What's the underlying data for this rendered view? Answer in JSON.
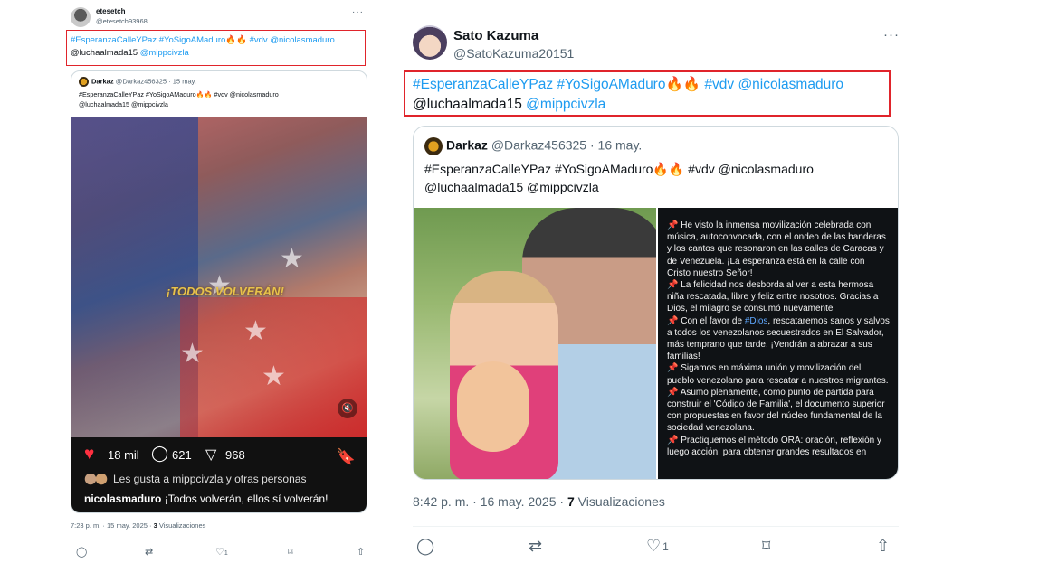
{
  "left_tweet": {
    "author_name": "etesetch",
    "author_handle": "@etesetch93968",
    "text_tags": "#EsperanzaCalleYPaz #YoSigoAMaduro",
    "text_emoji": "🔥🔥",
    "text_tags2": " #vdv @nicolasmaduro",
    "text_plain_mention": "@luchaalmada15",
    "text_mention": " @mippcivzla",
    "quote": {
      "author_name": "Darkaz",
      "author_meta": "@Darkaz456325 · 15 may.",
      "line1": "#EsperanzaCalleYPaz #YoSigoAMaduro🔥🔥 #vdv @nicolasmaduro",
      "line2": "@luchaalmada15 @mippcivzla"
    },
    "media_overlay_text": "¡TODOS VOLVERÁN!",
    "insta": {
      "likes": "18 mil",
      "comments": "621",
      "shares": "968",
      "liked_by": "Les gusta a mippcivzla y otras personas",
      "caption_user": "nicolasmaduro",
      "caption_text": " ¡Todos volverán, ellos sí volverán!"
    },
    "footer_time": "7:23 p. m. · 15 may. 2025 · ",
    "footer_views_count": "3",
    "footer_views_label": " Visualizaciones",
    "like_count": "1"
  },
  "right_tweet": {
    "author_name": "Sato Kazuma",
    "author_handle": "@SatoKazuma20151",
    "text_tags": "#EsperanzaCalleYPaz #YoSigoAMaduro",
    "text_emoji": "🔥🔥",
    "text_tags2": " #vdv @nicolasmaduro",
    "text_plain_mention": "@luchaalmada15",
    "text_mention": " @mippcivzla",
    "quote": {
      "author_name": "Darkaz",
      "author_meta": "@Darkaz456325 · 16 may.",
      "line1": "#EsperanzaCalleYPaz #YoSigoAMaduro🔥🔥 #vdv @nicolasmaduro",
      "line2": "@luchaalmada15 @mippcivzla",
      "panel": [
        "He visto la inmensa movilización celebrada con música, autoconvocada, con el ondeo de las banderas y los cantos que resonaron en las calles de Caracas y de Venezuela. ¡La esperanza está en la calle con Cristo nuestro Señor!",
        "La felicidad nos desborda al ver a esta hermosa niña rescatada, libre y feliz entre nosotros. Gracias a Dios, el milagro se consumó nuevamente",
        "Con el favor de ",
        "Sigamos en máxima unión y movilización del pueblo venezolano para rescatar a nuestros migrantes.",
        "Asumo plenamente, como punto de partida para construir el 'Código de Familia', el documento superior con propuestas en favor del núcleo fundamental de la sociedad venezolana.",
        "Practiquemos el método ORA: oración, reflexión y luego acción, para obtener grandes resultados en"
      ],
      "panel_link": "#Dios",
      "panel_p3_rest": ", rescataremos sanos y salvos a todos los venezolanos secuestrados en El Salvador, más temprano que tarde. ¡Vendrán a abrazar a sus familias!"
    },
    "footer_time": "8:42 p. m. · 16 may. 2025 · ",
    "footer_views_count": "7",
    "footer_views_label": " Visualizaciones",
    "like_count": "1"
  },
  "colors": {
    "link": "#1d9bf0",
    "highlight_box": "#e0242b"
  }
}
